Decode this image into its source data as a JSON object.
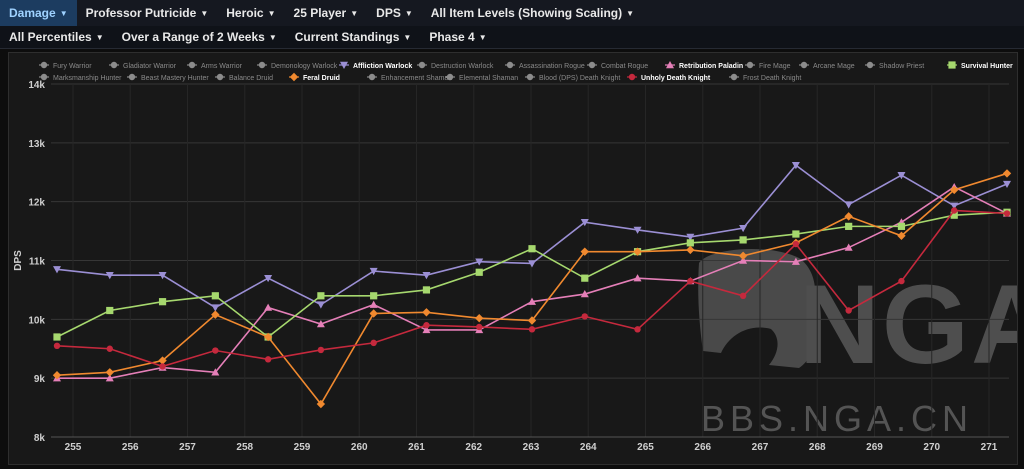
{
  "menu_primary": [
    {
      "label": "Damage",
      "active": true
    },
    {
      "label": "Professor Putricide",
      "active": false
    },
    {
      "label": "Heroic",
      "active": false
    },
    {
      "label": "25 Player",
      "active": false
    },
    {
      "label": "DPS",
      "active": false
    },
    {
      "label": "All Item Levels (Showing Scaling)",
      "active": false
    }
  ],
  "menu_secondary": [
    {
      "label": "All Percentiles"
    },
    {
      "label": "Over a Range of 2 Weeks"
    },
    {
      "label": "Current Standings"
    },
    {
      "label": "Phase 4"
    }
  ],
  "icons": {
    "dropdown": "chevron-down-icon"
  },
  "watermark": {
    "url_text": "BBS.NGA.CN",
    "logo_text": "NGA"
  },
  "colors": {
    "active_tab": "#1c3c60",
    "chart_bg": "#181818",
    "legend_muted": "#8c8c8c",
    "grid": "#3a3a3a"
  },
  "chart_data": {
    "type": "line",
    "ylabel": "DPS",
    "ylim": [
      8000,
      14000
    ],
    "yticks": [
      8000,
      9000,
      10000,
      11000,
      12000,
      13000,
      14000
    ],
    "ytick_labels": [
      "8k",
      "9k",
      "10k",
      "11k",
      "12k",
      "13k",
      "14k"
    ],
    "x": [
      255,
      256,
      257,
      258,
      259,
      260,
      261,
      262,
      263,
      264,
      265,
      266,
      267,
      268,
      269,
      270,
      271
    ],
    "grid": true,
    "legend_position": "top",
    "legend": [
      {
        "name": "Fury Warrior",
        "visible": false
      },
      {
        "name": "Gladiator Warrior",
        "visible": false
      },
      {
        "name": "Arms Warrior",
        "visible": false
      },
      {
        "name": "Demonology Warlock",
        "visible": false
      },
      {
        "name": "Affliction Warlock",
        "visible": true,
        "color": "#9b8fd4",
        "marker": "triangle-down"
      },
      {
        "name": "Destruction Warlock",
        "visible": false
      },
      {
        "name": "Assassination Rogue",
        "visible": false
      },
      {
        "name": "Combat Rogue",
        "visible": false
      },
      {
        "name": "Retribution Paladin",
        "visible": true,
        "color": "#e57fb8",
        "marker": "triangle-up"
      },
      {
        "name": "Fire Mage",
        "visible": false
      },
      {
        "name": "Arcane Mage",
        "visible": false
      },
      {
        "name": "Shadow Priest",
        "visible": false
      },
      {
        "name": "Survival Hunter",
        "visible": true,
        "color": "#a6d86e",
        "marker": "square"
      },
      {
        "name": "Marksmanship Hunter",
        "visible": false
      },
      {
        "name": "Beast Mastery Hunter",
        "visible": false
      },
      {
        "name": "Balance Druid",
        "visible": false
      },
      {
        "name": "Feral Druid",
        "visible": true,
        "color": "#f0892f",
        "marker": "diamond"
      },
      {
        "name": "Enhancement Shaman",
        "visible": false
      },
      {
        "name": "Elemental Shaman",
        "visible": false
      },
      {
        "name": "Blood (DPS) Death Knight",
        "visible": false
      },
      {
        "name": "Unholy Death Knight",
        "visible": true,
        "color": "#c5293d",
        "marker": "circle"
      },
      {
        "name": "Frost Death Knight",
        "visible": false
      }
    ],
    "series": [
      {
        "name": "Affliction Warlock",
        "color": "#9b8fd4",
        "marker": "triangle-down",
        "values": [
          10850,
          10750,
          10750,
          10200,
          10700,
          10250,
          10820,
          10750,
          10980,
          10950,
          11650,
          11520,
          11400,
          11550,
          12620,
          11950,
          12450,
          11930,
          12300
        ]
      },
      {
        "name": "Retribution Paladin",
        "color": "#e57fb8",
        "marker": "triangle-up",
        "values": [
          9000,
          9000,
          9180,
          9100,
          10200,
          9920,
          10250,
          9820,
          9820,
          10300,
          10430,
          10700,
          10650,
          11000,
          10980,
          11220,
          11650,
          12250,
          11800
        ]
      },
      {
        "name": "Survival Hunter",
        "color": "#a6d86e",
        "marker": "square",
        "values": [
          9700,
          10150,
          10300,
          10400,
          9700,
          10400,
          10400,
          10500,
          10800,
          11200,
          10700,
          11150,
          11300,
          11350,
          11450,
          11580,
          11580,
          11770,
          11820
        ]
      },
      {
        "name": "Feral Druid",
        "color": "#f0892f",
        "marker": "diamond",
        "values": [
          9050,
          9100,
          9300,
          10080,
          9700,
          8560,
          10100,
          10120,
          10020,
          9980,
          11150,
          11150,
          11180,
          11080,
          11300,
          11750,
          11420,
          12200,
          12480
        ]
      },
      {
        "name": "Unholy Death Knight",
        "color": "#c5293d",
        "marker": "circle",
        "values": [
          9550,
          9500,
          9200,
          9470,
          9320,
          9480,
          9600,
          9900,
          9870,
          9830,
          10050,
          9830,
          10650,
          10400,
          11280,
          10150,
          10650,
          11850,
          11800
        ]
      }
    ]
  }
}
